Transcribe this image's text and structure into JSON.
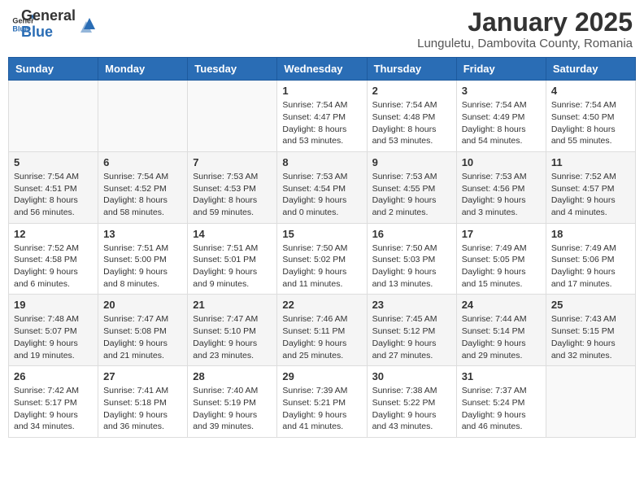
{
  "header": {
    "logo_general": "General",
    "logo_blue": "Blue",
    "month_title": "January 2025",
    "location": "Lunguletu, Dambovita County, Romania"
  },
  "weekdays": [
    "Sunday",
    "Monday",
    "Tuesday",
    "Wednesday",
    "Thursday",
    "Friday",
    "Saturday"
  ],
  "weeks": [
    [
      {
        "day": "",
        "info": ""
      },
      {
        "day": "",
        "info": ""
      },
      {
        "day": "",
        "info": ""
      },
      {
        "day": "1",
        "info": "Sunrise: 7:54 AM\nSunset: 4:47 PM\nDaylight: 8 hours and 53 minutes."
      },
      {
        "day": "2",
        "info": "Sunrise: 7:54 AM\nSunset: 4:48 PM\nDaylight: 8 hours and 53 minutes."
      },
      {
        "day": "3",
        "info": "Sunrise: 7:54 AM\nSunset: 4:49 PM\nDaylight: 8 hours and 54 minutes."
      },
      {
        "day": "4",
        "info": "Sunrise: 7:54 AM\nSunset: 4:50 PM\nDaylight: 8 hours and 55 minutes."
      }
    ],
    [
      {
        "day": "5",
        "info": "Sunrise: 7:54 AM\nSunset: 4:51 PM\nDaylight: 8 hours and 56 minutes."
      },
      {
        "day": "6",
        "info": "Sunrise: 7:54 AM\nSunset: 4:52 PM\nDaylight: 8 hours and 58 minutes."
      },
      {
        "day": "7",
        "info": "Sunrise: 7:53 AM\nSunset: 4:53 PM\nDaylight: 8 hours and 59 minutes."
      },
      {
        "day": "8",
        "info": "Sunrise: 7:53 AM\nSunset: 4:54 PM\nDaylight: 9 hours and 0 minutes."
      },
      {
        "day": "9",
        "info": "Sunrise: 7:53 AM\nSunset: 4:55 PM\nDaylight: 9 hours and 2 minutes."
      },
      {
        "day": "10",
        "info": "Sunrise: 7:53 AM\nSunset: 4:56 PM\nDaylight: 9 hours and 3 minutes."
      },
      {
        "day": "11",
        "info": "Sunrise: 7:52 AM\nSunset: 4:57 PM\nDaylight: 9 hours and 4 minutes."
      }
    ],
    [
      {
        "day": "12",
        "info": "Sunrise: 7:52 AM\nSunset: 4:58 PM\nDaylight: 9 hours and 6 minutes."
      },
      {
        "day": "13",
        "info": "Sunrise: 7:51 AM\nSunset: 5:00 PM\nDaylight: 9 hours and 8 minutes."
      },
      {
        "day": "14",
        "info": "Sunrise: 7:51 AM\nSunset: 5:01 PM\nDaylight: 9 hours and 9 minutes."
      },
      {
        "day": "15",
        "info": "Sunrise: 7:50 AM\nSunset: 5:02 PM\nDaylight: 9 hours and 11 minutes."
      },
      {
        "day": "16",
        "info": "Sunrise: 7:50 AM\nSunset: 5:03 PM\nDaylight: 9 hours and 13 minutes."
      },
      {
        "day": "17",
        "info": "Sunrise: 7:49 AM\nSunset: 5:05 PM\nDaylight: 9 hours and 15 minutes."
      },
      {
        "day": "18",
        "info": "Sunrise: 7:49 AM\nSunset: 5:06 PM\nDaylight: 9 hours and 17 minutes."
      }
    ],
    [
      {
        "day": "19",
        "info": "Sunrise: 7:48 AM\nSunset: 5:07 PM\nDaylight: 9 hours and 19 minutes."
      },
      {
        "day": "20",
        "info": "Sunrise: 7:47 AM\nSunset: 5:08 PM\nDaylight: 9 hours and 21 minutes."
      },
      {
        "day": "21",
        "info": "Sunrise: 7:47 AM\nSunset: 5:10 PM\nDaylight: 9 hours and 23 minutes."
      },
      {
        "day": "22",
        "info": "Sunrise: 7:46 AM\nSunset: 5:11 PM\nDaylight: 9 hours and 25 minutes."
      },
      {
        "day": "23",
        "info": "Sunrise: 7:45 AM\nSunset: 5:12 PM\nDaylight: 9 hours and 27 minutes."
      },
      {
        "day": "24",
        "info": "Sunrise: 7:44 AM\nSunset: 5:14 PM\nDaylight: 9 hours and 29 minutes."
      },
      {
        "day": "25",
        "info": "Sunrise: 7:43 AM\nSunset: 5:15 PM\nDaylight: 9 hours and 32 minutes."
      }
    ],
    [
      {
        "day": "26",
        "info": "Sunrise: 7:42 AM\nSunset: 5:17 PM\nDaylight: 9 hours and 34 minutes."
      },
      {
        "day": "27",
        "info": "Sunrise: 7:41 AM\nSunset: 5:18 PM\nDaylight: 9 hours and 36 minutes."
      },
      {
        "day": "28",
        "info": "Sunrise: 7:40 AM\nSunset: 5:19 PM\nDaylight: 9 hours and 39 minutes."
      },
      {
        "day": "29",
        "info": "Sunrise: 7:39 AM\nSunset: 5:21 PM\nDaylight: 9 hours and 41 minutes."
      },
      {
        "day": "30",
        "info": "Sunrise: 7:38 AM\nSunset: 5:22 PM\nDaylight: 9 hours and 43 minutes."
      },
      {
        "day": "31",
        "info": "Sunrise: 7:37 AM\nSunset: 5:24 PM\nDaylight: 9 hours and 46 minutes."
      },
      {
        "day": "",
        "info": ""
      }
    ]
  ]
}
